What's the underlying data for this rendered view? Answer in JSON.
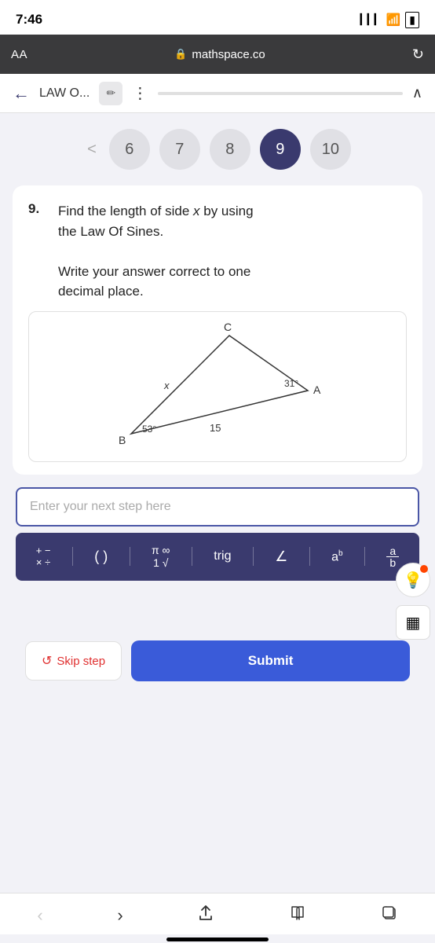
{
  "statusBar": {
    "time": "7:46",
    "signal": "▲▲▲",
    "wifi": "wifi",
    "battery": "battery"
  },
  "browserBar": {
    "aa": "AA",
    "lock": "🔒",
    "url": "mathspace.co",
    "refresh": "↻"
  },
  "navBar": {
    "back": "←",
    "title": "LAW O...",
    "editIcon": "✏",
    "dots": "⋮",
    "chevron": "∧"
  },
  "questionNumbers": {
    "prevArrow": "<",
    "numbers": [
      "6",
      "7",
      "8",
      "9",
      "10"
    ],
    "activeIndex": 3
  },
  "question": {
    "number": "9.",
    "line1": "Find the length of side ",
    "var": "x",
    "line1end": " by using",
    "line2": "the Law Of Sines.",
    "line3": "Write your answer correct to one",
    "line4": "decimal place."
  },
  "diagram": {
    "vertices": {
      "A": "A",
      "B": "B",
      "C": "C"
    },
    "labels": {
      "x": "x",
      "side15": "15",
      "angle31": "31°",
      "angle53": "53°"
    }
  },
  "input": {
    "placeholder": "Enter your next step here"
  },
  "mathToolbar": {
    "buttons": [
      {
        "label": "÷×",
        "sub": "x÷",
        "id": "arith"
      },
      {
        "label": "(  )",
        "id": "parens"
      },
      {
        "label": "π∞\n1√",
        "id": "constants"
      },
      {
        "label": "trig",
        "id": "trig"
      },
      {
        "label": "∠",
        "id": "angle"
      },
      {
        "label": "aᵇ",
        "id": "power"
      },
      {
        "label": "a/b",
        "id": "fraction"
      }
    ]
  },
  "hints": {
    "lightbulb": "💡",
    "grid": "▦"
  },
  "actions": {
    "skipIcon": "↺",
    "skipLabel": "Skip step",
    "submitLabel": "Submit"
  },
  "browserNav": {
    "back": "<",
    "forward": ">",
    "share": "share",
    "book": "book",
    "tabs": "tabs"
  }
}
